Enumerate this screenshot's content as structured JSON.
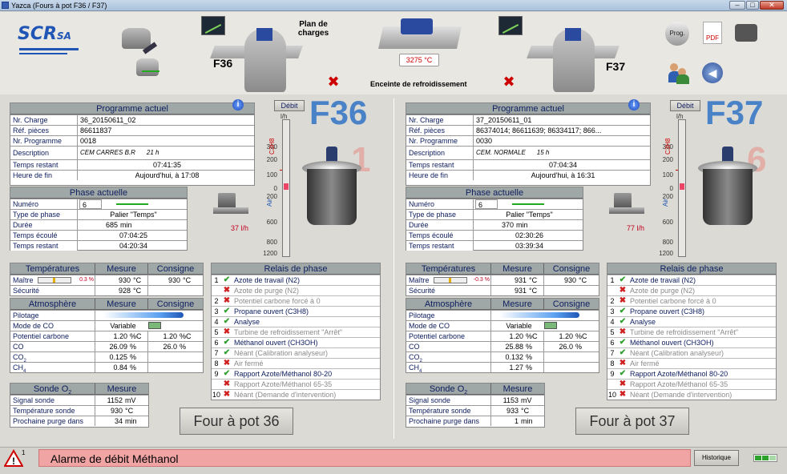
{
  "window": {
    "title": "Yazca (Fours à pot F36 / F37)"
  },
  "header": {
    "logo_main": "SCR",
    "logo_sub": "SA",
    "plan_label": "Plan de charges",
    "f36_label": "F36",
    "f37_label": "F37",
    "cooling_temp": "3275 °C",
    "cooling_label": "Enceinte de refroidissement",
    "prog_icon_label": "Prog.",
    "pdf_icon_label": "PDF"
  },
  "labels": {
    "programme_actuel": "Programme actuel",
    "nr_charge": "Nr. Charge",
    "ref_pieces": "Réf. pièces",
    "nr_programme": "Nr. Programme",
    "description": "Description",
    "temps_restant": "Temps restant",
    "heure_fin": "Heure de fin",
    "phase_actuelle": "Phase actuelle",
    "numero": "Numéro",
    "type_phase": "Type de phase",
    "duree": "Durée",
    "temps_ecoule": "Temps écoulé",
    "temperatures": "Températures",
    "mesure": "Mesure",
    "consigne": "Consigne",
    "maitre": "Maître",
    "securite": "Sécurité",
    "atmosphere": "Atmosphère",
    "pilotage": "Pilotage",
    "mode_co": "Mode de CO",
    "potentiel": "Potentiel carbone",
    "co": "CO",
    "co2": "CO2",
    "ch4": "CH4",
    "sonde": "Sonde O2",
    "signal": "Signal sonde",
    "temp_sonde": "Température sonde",
    "purge": "Prochaine purge dans",
    "relais": "Relais de phase",
    "debit": "Débit",
    "lh": "l/h",
    "c3h8": "C3H8",
    "air": "Air",
    "min": "min",
    "unit_c": "°C",
    "unit_pc": "%C",
    "unit_p": "%",
    "unit_mv": "mV"
  },
  "scale_ticks": [
    "300",
    "200",
    "100",
    "0",
    "200",
    "400",
    "600",
    "800",
    "1200"
  ],
  "f36": {
    "big_label": "F36",
    "phase_ghost": "1",
    "flow": "37 l/h",
    "charge": "36_20150611_02",
    "ref": "86611837",
    "programme": "0018",
    "desc": "CEM CARRES B.R",
    "desc_time": "21 h",
    "temps_restant": "07:41:35",
    "heure_fin": "Aujourd'hui, à 17:08",
    "numero": "6",
    "type_phase": "Palier \"Temps\"",
    "duree": "685",
    "ecoule": "07:04:25",
    "restant": "04:20:34",
    "maitre_pct": "0.3 %",
    "maitre_mesure": "930",
    "maitre_consigne": "930",
    "securite": "928",
    "mode_co": "Variable",
    "pot_mesure": "1.20",
    "pot_consigne": "1.20",
    "co_mesure": "26.09",
    "co_consigne": "26.0",
    "co2": "0.125",
    "ch4": "0.84",
    "signal": "1152",
    "temp_sonde": "930",
    "purge": "34",
    "button": "Four à pot 36"
  },
  "f37": {
    "big_label": "F37",
    "phase_ghost": "6",
    "flow": "77 l/h",
    "charge": "37_20150611_01",
    "ref": "86374014; 86611639; 86334117; 866...",
    "programme": "0030",
    "desc": "CEM. NORMALE",
    "desc_time": "15 h",
    "temps_restant": "07:04:34",
    "heure_fin": "Aujourd'hui, à 16:31",
    "numero": "6",
    "type_phase": "Palier \"Temps\"",
    "duree": "370",
    "ecoule": "02:30:26",
    "restant": "03:39:34",
    "maitre_pct": "-0.3 %",
    "maitre_mesure": "931",
    "maitre_consigne": "930",
    "securite": "931",
    "mode_co": "Variable",
    "pot_mesure": "1.20",
    "pot_consigne": "1.20",
    "co_mesure": "25.88",
    "co_consigne": "26.0",
    "co2": "0.132",
    "ch4": "1.27",
    "signal": "1153",
    "temp_sonde": "933",
    "purge": "1",
    "button": "Four à pot 37"
  },
  "relays": [
    {
      "n": "1",
      "state": "ok",
      "label": "Azote de travail (N2)",
      "active": true
    },
    {
      "n": "",
      "state": "no",
      "label": "Azote de purge (N2)",
      "active": false
    },
    {
      "n": "2",
      "state": "no",
      "label": "Potentiel carbone forcé à 0",
      "active": false
    },
    {
      "n": "3",
      "state": "ok",
      "label": "Propane ouvert (C3H8)",
      "active": true
    },
    {
      "n": "4",
      "state": "ok",
      "label": "Analyse",
      "active": true
    },
    {
      "n": "5",
      "state": "no",
      "label": "Turbine de refroidissement \"Arrêt\"",
      "active": false
    },
    {
      "n": "6",
      "state": "ok",
      "label": "Méthanol ouvert (CH3OH)",
      "active": true
    },
    {
      "n": "7",
      "state": "ok",
      "label": "Néant (Calibration analyseur)",
      "active": false
    },
    {
      "n": "8",
      "state": "no",
      "label": "Air fermé",
      "active": false
    },
    {
      "n": "9",
      "state": "ok",
      "label": "Rapport Azote/Méthanol 80-20",
      "active": true
    },
    {
      "n": "",
      "state": "no",
      "label": "Rapport Azote/Méthanol 65-35",
      "active": false
    },
    {
      "n": "10",
      "state": "no",
      "label": "Néant (Demande d'intervention)",
      "active": false
    }
  ],
  "status": {
    "alarm": "Alarme de débit Méthanol",
    "alarm_count": "1",
    "historique": "Historique"
  }
}
